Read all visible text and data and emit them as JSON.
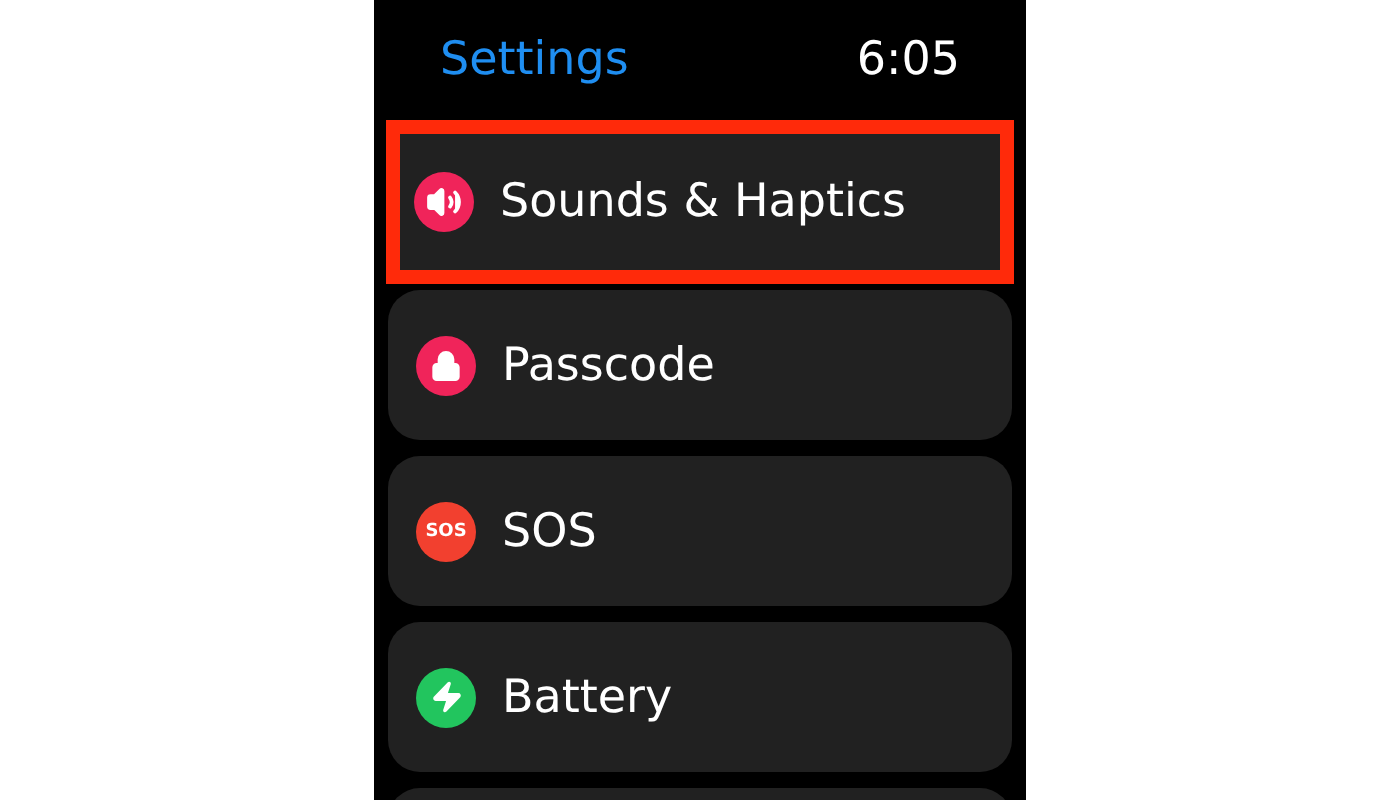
{
  "header": {
    "title": "Settings",
    "time": "6:05"
  },
  "items": [
    {
      "label": "Sounds & Haptics",
      "kind": "speaker",
      "color": "#f0245a",
      "highlighted": true
    },
    {
      "label": "Passcode",
      "kind": "lock",
      "color": "#f0245a",
      "highlighted": false
    },
    {
      "label": "SOS",
      "kind": "sos",
      "badge": "SOS",
      "color": "#f2402f",
      "highlighted": false
    },
    {
      "label": "Battery",
      "kind": "bolt",
      "color": "#22c55e",
      "highlighted": false
    }
  ]
}
